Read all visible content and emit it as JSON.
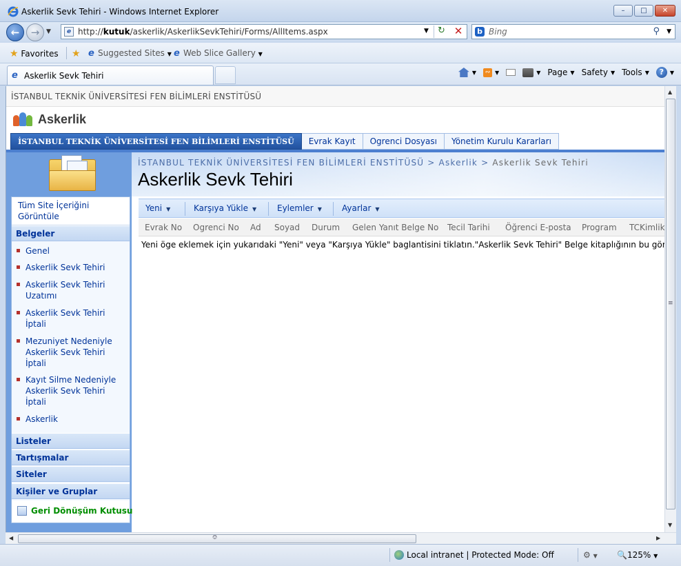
{
  "window": {
    "title": "Askerlik Sevk Tehiri - Windows Internet Explorer",
    "controls": {
      "minimize": "–",
      "maximize": "□",
      "close": "✕"
    }
  },
  "address_bar": {
    "url_prefix": "http://",
    "url_host": "kutuk",
    "url_path": "/askerlik/AskerlikSevkTehiri/Forms/AllItems.aspx",
    "search_placeholder": "Bing"
  },
  "favorites_bar": {
    "favorites_label": "Favorites",
    "suggested_sites": "Suggested Sites",
    "web_slice_gallery": "Web Slice Gallery"
  },
  "tabs": [
    {
      "label": "Askerlik Sevk Tehiri",
      "active": true
    }
  ],
  "command_bar": {
    "page": "Page",
    "safety": "Safety",
    "tools": "Tools"
  },
  "sharepoint": {
    "top_site_title": "İSTANBUL TEKNİK ÜNİVERSİTESİ FEN BİLİMLERİ ENSTİTÜSÜ",
    "site_name": "Askerlik",
    "nav_tabs": [
      {
        "label": "İSTANBUL TEKNİK ÜNİVERSİTESİ FEN BİLİMLERİ ENSTİTÜSÜ",
        "active": true
      },
      {
        "label": "Evrak Kayıt"
      },
      {
        "label": "Ogrenci Dosyası"
      },
      {
        "label": "Yönetim Kurulu Kararları"
      }
    ],
    "breadcrumb": {
      "root": "İSTANBUL TEKNİK ÜNİVERSİTESİ FEN BİLİMLERİ ENSTİTÜSÜ",
      "sep": ">",
      "site": "Askerlik",
      "current": "Askerlik Sevk Tehiri"
    },
    "page_title": "Askerlik Sevk Tehiri",
    "quick_launch": {
      "view_all": "Tüm Site İçeriğini Görüntüle",
      "documents_heading": "Belgeler",
      "documents": [
        "Genel",
        "Askerlik Sevk Tehiri",
        "Askerlik Sevk Tehiri Uzatımı",
        "Askerlik Sevk Tehiri İptali",
        "Mezuniyet Nedeniyle Askerlik Sevk Tehiri İptali",
        "Kayıt Silme Nedeniyle Askerlik Sevk Tehiri İptali",
        "Askerlik"
      ],
      "sections": [
        "Listeler",
        "Tartışmalar",
        "Siteler",
        "Kişiler ve Gruplar"
      ],
      "recycle_bin": "Geri Dönüşüm Kutusu"
    },
    "toolbar": {
      "new": "Yeni",
      "upload": "Karşıya Yükle",
      "actions": "Eylemler",
      "settings": "Ayarlar"
    },
    "columns": [
      "Evrak No",
      "Ogrenci No",
      "Ad",
      "Soyad",
      "Durum",
      "Gelen Yanıt Belge No",
      "Tecil Tarihi",
      "Öğrenci E-posta",
      "Program",
      "TCKimlik"
    ],
    "empty_message": "Yeni öge eklemek için yukarıdaki \"Yeni\" veya \"Karşıya Yükle\" baglantisini tiklatın.\"Askerlik Sevk Tehiri\" Belge kitaplığının bu görünümde"
  },
  "status_bar": {
    "zone": "Local intranet | Protected Mode: Off",
    "zoom": "125%"
  },
  "colors": {
    "nav_active": "#22529f",
    "link": "#003399",
    "recycle": "#018e00",
    "left_panel": "#6f9ede"
  }
}
